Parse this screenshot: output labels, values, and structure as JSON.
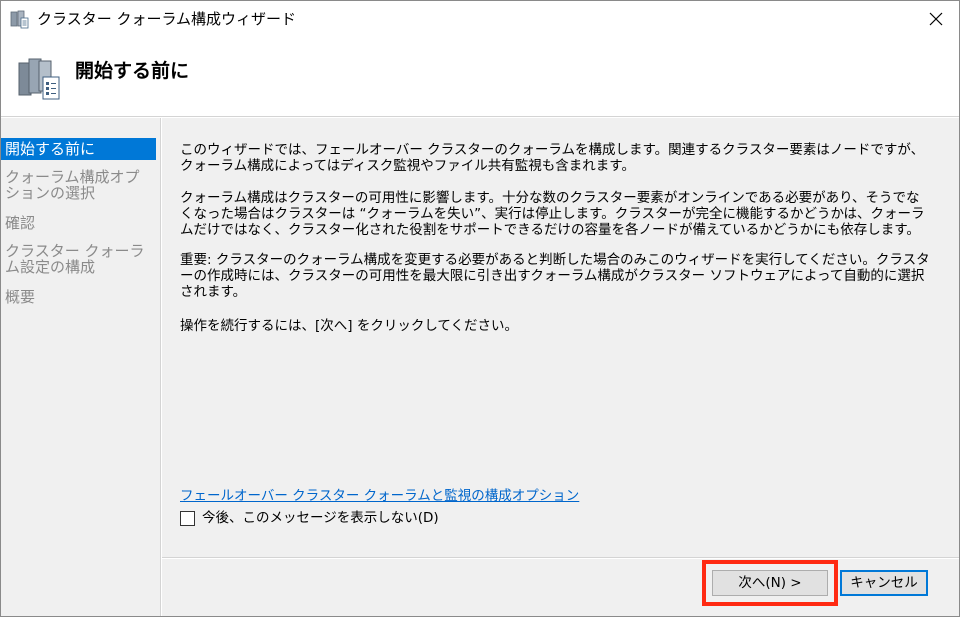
{
  "window": {
    "title": "クラスター クォーラム構成ウィザード",
    "close_icon": "close-icon"
  },
  "header": {
    "title": "開始する前に",
    "icon": "cluster-servers-icon"
  },
  "sidebar": {
    "items": [
      {
        "label": "開始する前に",
        "active": true
      },
      {
        "label": "クォーラム構成オプションの選択",
        "active": false
      },
      {
        "label": "確認",
        "active": false
      },
      {
        "label": "クラスター クォーラム設定の構成",
        "active": false
      },
      {
        "label": "概要",
        "active": false
      }
    ]
  },
  "main": {
    "paragraphs": [
      "このウィザードでは、フェールオーバー クラスターのクォーラムを構成します。関連するクラスター要素はノードですが、クォーラム構成によってはディスク監視やファイル共有監視も含まれます。",
      "クォーラム構成はクラスターの可用性に影響します。十分な数のクラスター要素がオンラインである必要があり、そうでなくなった場合はクラスターは “クォーラムを失い”、実行は停止します。クラスターが完全に機能するかどうかは、クォーラムだけではなく、クラスター化された役割をサポートできるだけの容量を各ノードが備えているかどうかにも依存します。",
      "重要: クラスターのクォーラム構成を変更する必要があると判断した場合のみこのウィザードを実行してください。クラスターの作成時には、クラスターの可用性を最大限に引き出すクォーラム構成がクラスター ソフトウェアによって自動的に選択されます。",
      "操作を続行するには、[次へ] をクリックしてください。"
    ],
    "link": "フェールオーバー クラスター クォーラムと監視の構成オプション",
    "checkbox_label": "今後、このメッセージを表示しない(D)",
    "checkbox_checked": false
  },
  "footer": {
    "next_label": "次へ(N) >",
    "cancel_label": "キャンセル"
  },
  "colors": {
    "accent": "#0078d7",
    "highlight": "#ff2a12",
    "link": "#0066cc"
  }
}
